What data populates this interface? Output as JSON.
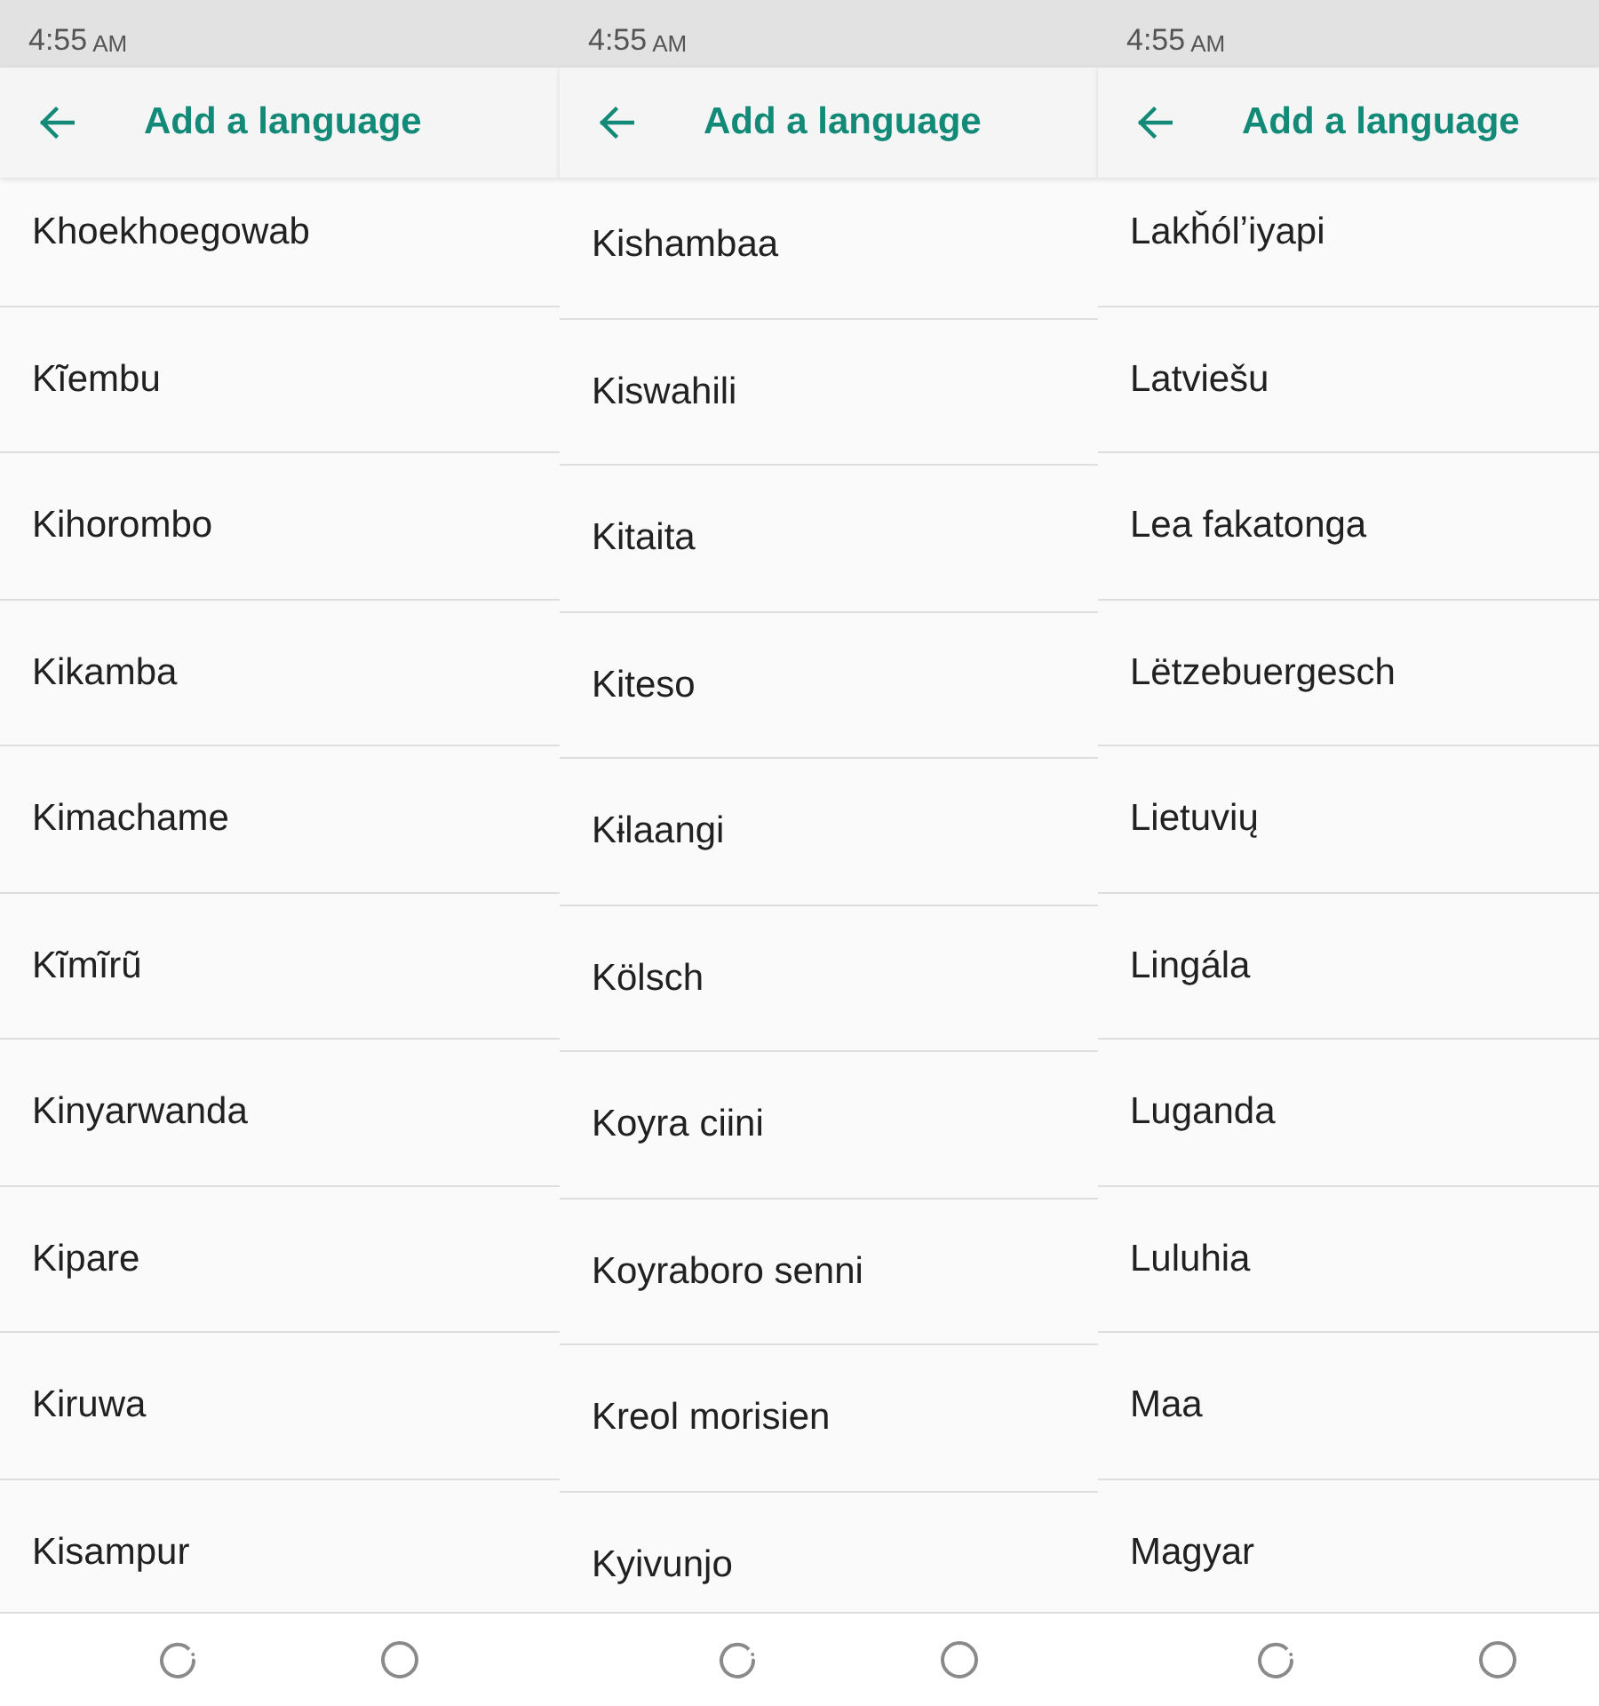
{
  "screens": [
    {
      "status_bar": {
        "time": "4:55",
        "period": "AM"
      },
      "app_bar": {
        "title": "Add a language"
      },
      "languages": [
        "Khoekhoegowab",
        "Kĩembu",
        "Kihorombo",
        "Kikamba",
        "Kimachame",
        "Kĩmĩrũ",
        "Kinyarwanda",
        "Kipare",
        "Kiruwa",
        "Kisampur"
      ]
    },
    {
      "status_bar": {
        "time": "4:55",
        "period": "AM"
      },
      "app_bar": {
        "title": "Add a language"
      },
      "languages": [
        "Kishambaa",
        "Kiswahili",
        "Kitaita",
        "Kiteso",
        "Kɨlaangi",
        "Kölsch",
        "Koyra ciini",
        "Koyraboro senni",
        "Kreol morisien",
        "Kyivunjo"
      ]
    },
    {
      "status_bar": {
        "time": "4:55",
        "period": "AM"
      },
      "app_bar": {
        "title": "Add a language"
      },
      "languages": [
        "Lakȟólʼiyapi",
        "Latviešu",
        "Lea fakatonga",
        "Lëtzebuergesch",
        "Lietuvių",
        "Lingála",
        "Luganda",
        "Luluhia",
        "Maa",
        "Magyar"
      ]
    }
  ]
}
